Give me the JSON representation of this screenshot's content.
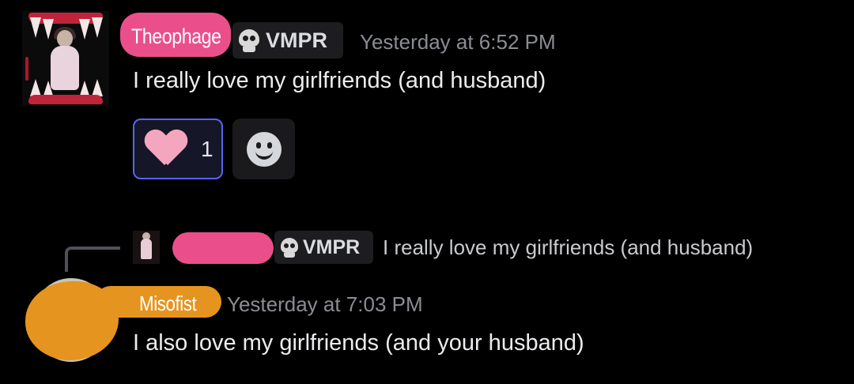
{
  "messages": [
    {
      "author": "Theophage",
      "role_tag": "VMPR",
      "timestamp": "Yesterday at 6:52 PM",
      "content": "I really love my girlfriends (and husband)",
      "reactions": [
        {
          "emoji": "pink-heart",
          "count": "1",
          "selected": true
        }
      ]
    },
    {
      "reply_to": {
        "role_tag": "VMPR",
        "content": "I really love my girlfriends (and husband)"
      },
      "author": "Misofist",
      "timestamp": "Yesterday at 7:03 PM",
      "content": "I also love my girlfriends (and your husband)"
    }
  ],
  "icons": {
    "role_icon": "skull-icon",
    "add_reaction": "smiley-face-icon"
  },
  "colors": {
    "background": "#000000",
    "name_highlight_pink": "#ea4f8b",
    "name_highlight_orange": "#e59420",
    "reaction_selected_border": "#5865f2",
    "timestamp": "#8b8d94"
  }
}
